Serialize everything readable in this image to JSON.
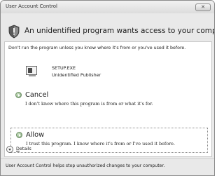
{
  "window": {
    "title": "User Account Control",
    "close_label": "✕"
  },
  "header": {
    "text": "An unidentified program wants access to your computer",
    "icon": "shield-icon"
  },
  "warning": {
    "text": "Don't run the program unless you know where it's from or you've used it before."
  },
  "program": {
    "name": "SETUP.EXE",
    "publisher": "Unidentified Publisher",
    "icon": "program-icon"
  },
  "options": {
    "cancel": {
      "title": "Cancel",
      "description": "I don't know where this program is from or what it's for.",
      "icon": "arrow-icon"
    },
    "allow": {
      "title": "Allow",
      "description": "I trust this program. I know where it's from or I've used it before.",
      "icon": "arrow-icon"
    }
  },
  "details": {
    "label_first": "D",
    "label_rest": "etails",
    "icon": "chevron-down-icon"
  },
  "footer": {
    "text": "User Account Control helps stop unauthorized changes to your computer."
  }
}
